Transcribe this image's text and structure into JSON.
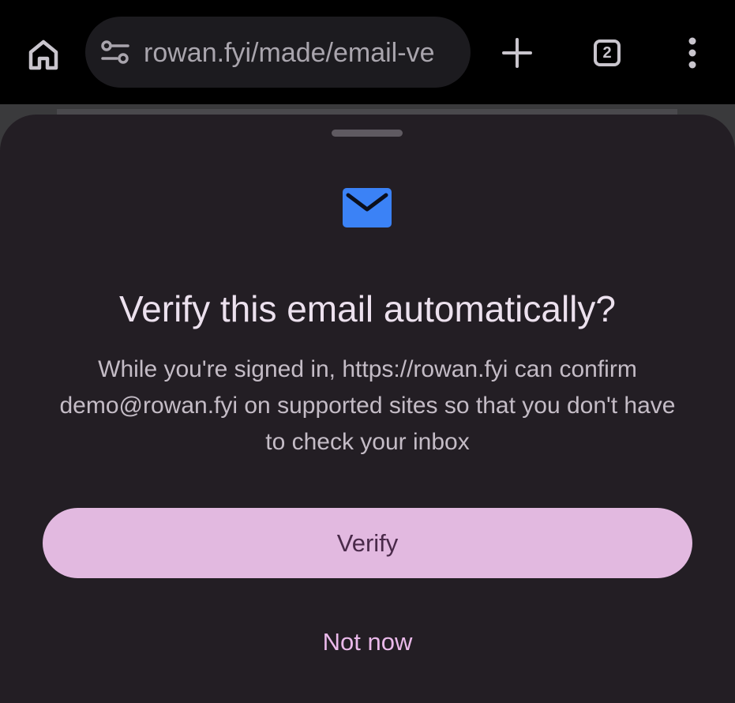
{
  "toolbar": {
    "url": "rowan.fyi/made/email-ve",
    "tab_count": "2",
    "icons": {
      "home": "home-icon",
      "site_settings": "tune-icon",
      "new_tab": "plus-icon",
      "tab_switcher": "tab-switcher-icon",
      "menu": "more-vert-icon"
    }
  },
  "sheet": {
    "icon": "email-icon",
    "title": "Verify this email automatically?",
    "body": "While you're signed in, https://rowan.fyi can confirm demo@rowan.fyi on supported sites so that you don't have to check your inbox",
    "primary_label": "Verify",
    "secondary_label": "Not now"
  },
  "colors": {
    "sheet_bg": "#231e24",
    "primary_button": "#e2b9e0",
    "primary_text": "#4a2a4a",
    "secondary_text": "#eab9ea",
    "email_icon": "#3b82f6"
  }
}
